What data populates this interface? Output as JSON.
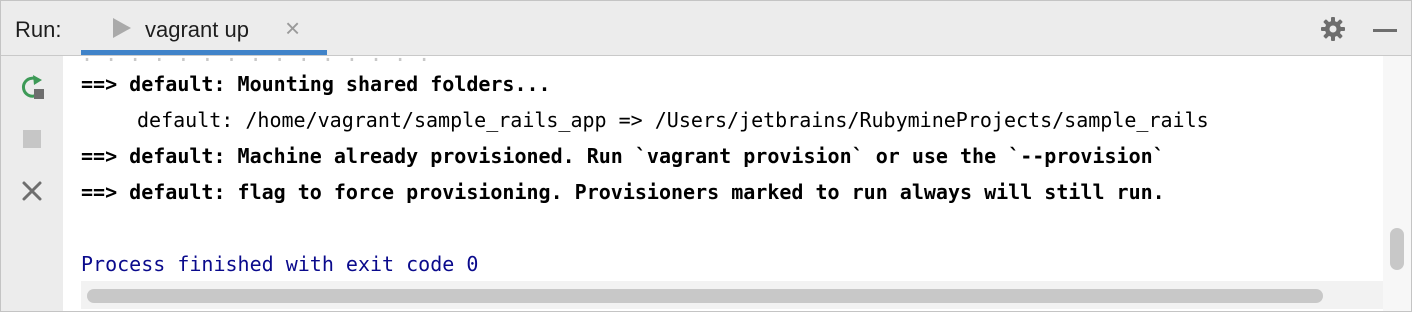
{
  "header": {
    "run_label": "Run:",
    "tab_title": "vagrant up",
    "tab_close_glyph": "×"
  },
  "toolbar": {
    "icons": [
      "rerun-icon",
      "stop-icon",
      "close-icon"
    ],
    "rerun_color": "#3d9a57"
  },
  "console": {
    "faded_text": ". . . . . . . . . . . . . . .",
    "lines": [
      "==> default: Mounting shared folders...",
      "default: /home/vagrant/sample_rails_app => /Users/jetbrains/RubymineProjects/sample_rails",
      "==> default: Machine already provisioned. Run `vagrant provision` or use the `--provision`",
      "==> default: flag to force provisioning. Provisioners marked to run always will still run.",
      "Process finished with exit code 0"
    ],
    "exit_text_color": "#0a0a8c"
  },
  "colors": {
    "accent_tab_underline": "#4083c9",
    "header_bg": "#ececec"
  }
}
